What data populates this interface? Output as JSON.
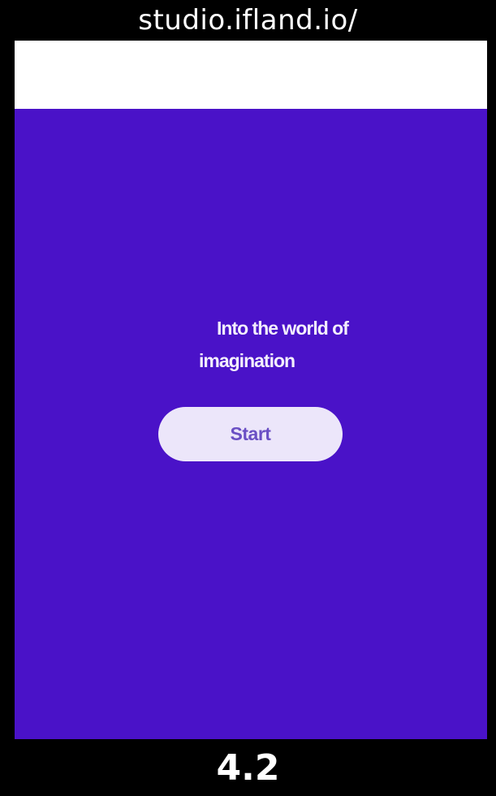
{
  "caption": {
    "url": "studio.ifland.io/",
    "speed": "4.2"
  },
  "hero": {
    "tagline_line1": "Into the world of",
    "tagline_line2": "imagination",
    "start_label": "Start"
  },
  "colors": {
    "hero_background": "#4a12c8",
    "button_background": "#ece6fa",
    "button_text": "#6a4fc4",
    "top_bar": "#ffffff",
    "caption_background": "#000000"
  }
}
